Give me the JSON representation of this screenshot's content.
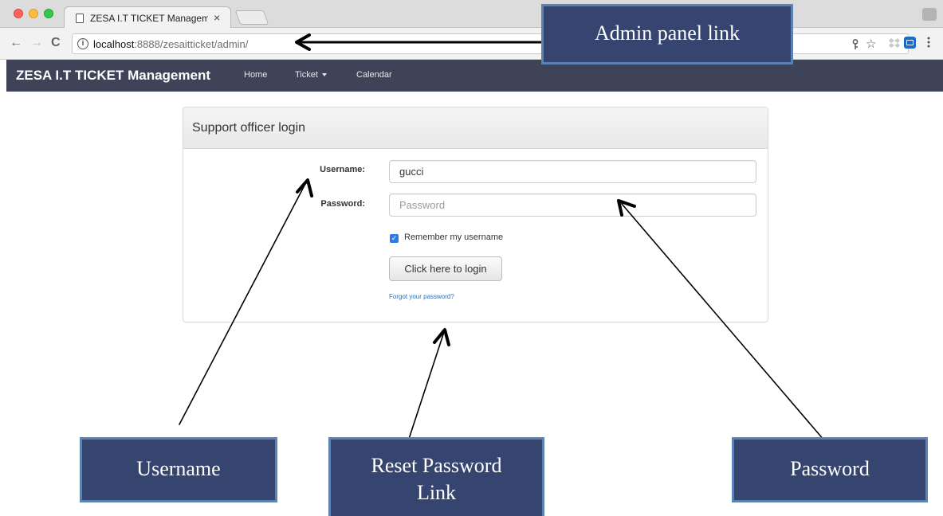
{
  "browser": {
    "tab_title": "ZESA I.T TICKET Management",
    "tab_close": "×",
    "url_host": "localhost",
    "url_path": ":8888/zesaitticket/admin/",
    "nav": {
      "back": "←",
      "forward": "→",
      "reload": "C"
    },
    "icons": {
      "info": "i",
      "key": "🝖",
      "star": "☆"
    }
  },
  "app_nav": {
    "brand": "ZESA I.T TICKET Management",
    "items": [
      {
        "label": "Home"
      },
      {
        "label": "Ticket"
      },
      {
        "label": "Calendar"
      }
    ]
  },
  "login_panel": {
    "title": "Support officer login",
    "username_label": "Username:",
    "username_value": "gucci",
    "password_label": "Password:",
    "password_placeholder": "Password",
    "remember_checked": true,
    "remember_label": "Remember my username",
    "login_button": "Click here to login",
    "forgot_link": "Forgot your password?"
  },
  "annotations": {
    "admin_panel_link": "Admin panel link",
    "username": "Username",
    "reset_password_line1": "Reset Password",
    "reset_password_line2": "Link",
    "password": "Password"
  },
  "colors": {
    "navbar_bg": "#3e4357",
    "callout_bg": "#364570",
    "callout_border": "#5b82b5",
    "link": "#2a6ebb",
    "checkbox": "#2f7ae5"
  }
}
